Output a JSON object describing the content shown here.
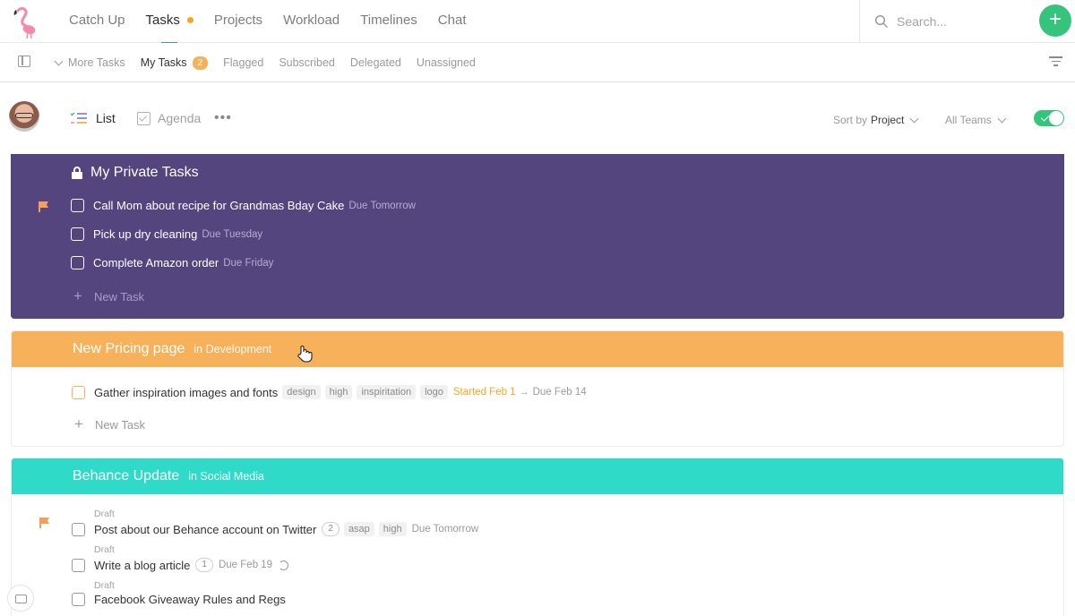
{
  "topnav": {
    "items": [
      {
        "label": "Catch Up"
      },
      {
        "label": "Tasks",
        "active": true,
        "dot": true
      },
      {
        "label": "Projects"
      },
      {
        "label": "Workload"
      },
      {
        "label": "Timelines"
      },
      {
        "label": "Chat"
      }
    ],
    "search_placeholder": "Search...",
    "add_label": "+"
  },
  "subnav": {
    "more_tasks": "More Tasks",
    "my_tasks": "My Tasks",
    "my_tasks_count": "2",
    "flagged": "Flagged",
    "subscribed": "Subscribed",
    "delegated": "Delegated",
    "unassigned": "Unassigned"
  },
  "toolbar": {
    "list_label": "List",
    "agenda_label": "Agenda",
    "more_label": "•••",
    "sort_prefix": "Sort by",
    "sort_value": "Project",
    "teams_label": "All Teams",
    "toggle_on": true
  },
  "private": {
    "title": "My Private Tasks",
    "color": "#55457f",
    "tasks": [
      {
        "title": "Call Mom about recipe for Grandmas Bday Cake",
        "due": "Due Tomorrow",
        "flagged": true
      },
      {
        "title": "Pick up dry cleaning",
        "due": "Due Tuesday"
      },
      {
        "title": "Complete Amazon order",
        "due": "Due Friday"
      }
    ],
    "new_task": "New Task"
  },
  "projects": [
    {
      "name": "New Pricing page",
      "team": "in Development",
      "color": "#f6b15a",
      "tasks": [
        {
          "title": "Gather inspiration images and fonts",
          "tags": [
            "design",
            "high",
            "inspiritation",
            "logo"
          ],
          "started": "Started Feb 1",
          "arrow": "→",
          "due": "Due Feb 14"
        }
      ],
      "new_task": "New Task"
    },
    {
      "name": "Behance Update",
      "team": "in Social Media",
      "color": "#2fdbc8",
      "tasks": [
        {
          "draft": "Draft",
          "title": "Post about our Behance account on Twitter",
          "count": "2",
          "tags": [
            "asap",
            "high"
          ],
          "due": "Due Tomorrow",
          "flagged": true
        },
        {
          "draft": "Draft",
          "title": "Write a blog article",
          "count": "1",
          "due": "Due Feb 19",
          "repeat": true
        },
        {
          "draft": "Draft",
          "title": "Facebook Giveaway Rules and Regs"
        }
      ]
    }
  ],
  "colors": {
    "accent": "#34c47c",
    "badge": "#f6b15a",
    "flag": "#f5a05a",
    "nav_underline": "#3b8de0"
  }
}
